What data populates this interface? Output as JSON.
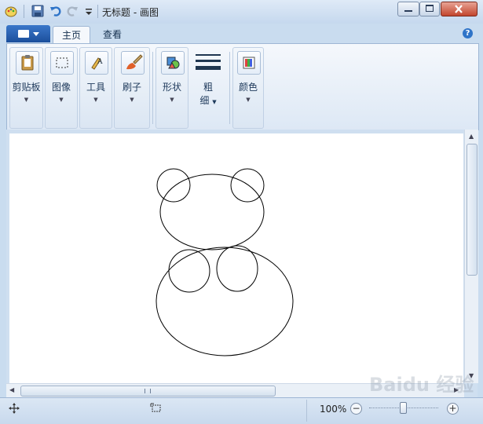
{
  "window": {
    "title": "无标题 - 画图"
  },
  "ribbon": {
    "tabs": [
      {
        "label": "主页",
        "active": true
      },
      {
        "label": "查看",
        "active": false
      }
    ],
    "groups": [
      {
        "label": "剪贴板",
        "icon": "clipboard-icon"
      },
      {
        "label": "图像",
        "icon": "select-rect-icon"
      },
      {
        "label": "工具",
        "icon": "tools-icon"
      },
      {
        "label": "刷子",
        "icon": "brush-icon"
      },
      {
        "label": "形状",
        "icon": "shapes-icon"
      },
      {
        "label": "粗",
        "label2": "细",
        "icon": "stroke-size-icon"
      },
      {
        "label": "颜色",
        "icon": "colors-icon"
      }
    ],
    "help_glyph": "?"
  },
  "status": {
    "zoom": "100%"
  },
  "watermark": "Baidu 经验",
  "colors": {
    "accent": "#1c4f9c",
    "frame": "#c9dcef"
  }
}
